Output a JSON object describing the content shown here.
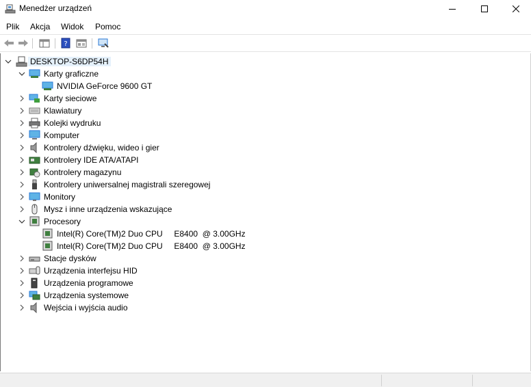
{
  "window": {
    "title": "Menedżer urządzeń"
  },
  "menu": [
    "Plik",
    "Akcja",
    "Widok",
    "Pomoc"
  ],
  "tree": {
    "root": "DESKTOP-S6DP54H",
    "items": [
      {
        "label": "Karty graficzne",
        "icon": "display-adapter-icon",
        "expanded": true,
        "children": [
          "NVIDIA GeForce 9600 GT"
        ]
      },
      {
        "label": "Karty sieciowe",
        "icon": "network-adapter-icon"
      },
      {
        "label": "Klawiatury",
        "icon": "keyboard-icon"
      },
      {
        "label": "Kolejki wydruku",
        "icon": "printer-icon"
      },
      {
        "label": "Komputer",
        "icon": "computer-icon"
      },
      {
        "label": "Kontrolery dźwięku, wideo i gier",
        "icon": "speaker-icon"
      },
      {
        "label": "Kontrolery IDE ATA/ATAPI",
        "icon": "ide-controller-icon"
      },
      {
        "label": "Kontrolery magazynu",
        "icon": "storage-controller-icon"
      },
      {
        "label": "Kontrolery uniwersalnej magistrali szeregowej",
        "icon": "usb-icon"
      },
      {
        "label": "Monitory",
        "icon": "monitor-icon"
      },
      {
        "label": "Mysz i inne urządzenia wskazujące",
        "icon": "mouse-icon"
      },
      {
        "label": "Procesory",
        "icon": "processor-icon",
        "expanded": true,
        "children": [
          "Intel(R) Core(TM)2 Duo CPU     E8400  @ 3.00GHz",
          "Intel(R) Core(TM)2 Duo CPU     E8400  @ 3.00GHz"
        ]
      },
      {
        "label": "Stacje dysków",
        "icon": "disk-drive-icon"
      },
      {
        "label": "Urządzenia interfejsu HID",
        "icon": "hid-icon"
      },
      {
        "label": "Urządzenia programowe",
        "icon": "software-device-icon"
      },
      {
        "label": "Urządzenia systemowe",
        "icon": "system-device-icon"
      },
      {
        "label": "Wejścia i wyjścia audio",
        "icon": "audio-io-icon"
      }
    ]
  },
  "colors": {
    "selection": "#e5f1fb",
    "accent": "#2b79d6",
    "chip": "#3f7f3f"
  }
}
